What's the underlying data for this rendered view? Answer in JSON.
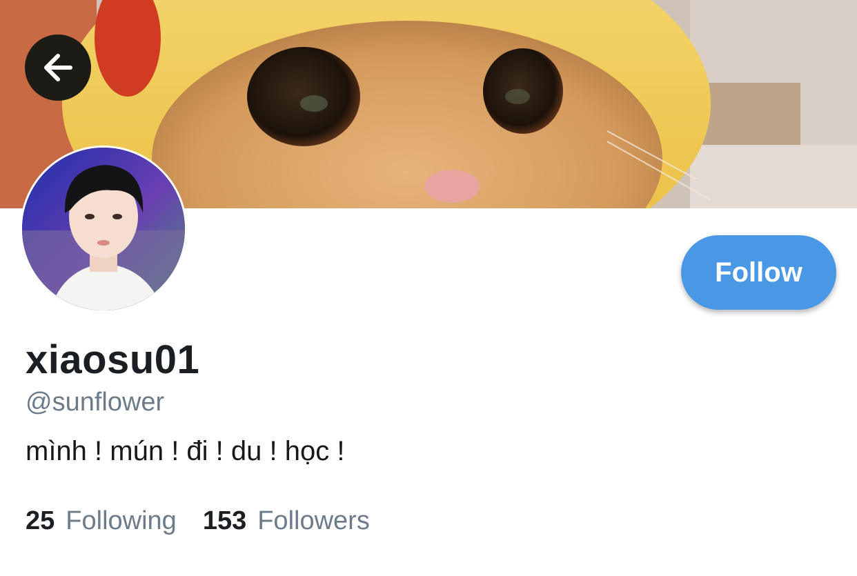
{
  "profile": {
    "display_name": "xiaosu01",
    "handle": "@sunflower",
    "bio": "mình ! mún ! đi ! du ! học !",
    "follow_label": "Follow"
  },
  "stats": {
    "following_count": "25",
    "following_label": "Following",
    "followers_count": "153",
    "followers_label": "Followers"
  },
  "icons": {
    "back": "arrow-left-icon"
  },
  "colors": {
    "accent": "#4a97e6",
    "primary_text": "#1b1f23",
    "secondary_text": "#6c7b89"
  }
}
